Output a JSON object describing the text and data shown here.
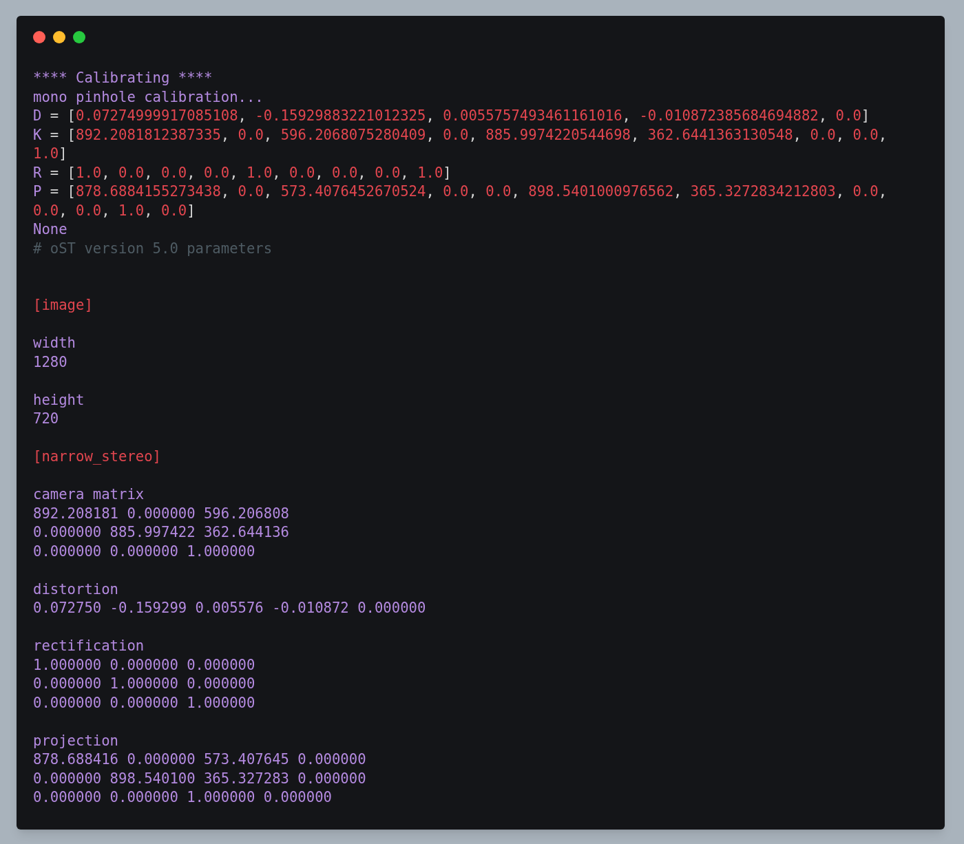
{
  "window": {
    "controls": [
      {
        "kind": "close"
      },
      {
        "kind": "minimize"
      },
      {
        "kind": "zoom"
      }
    ]
  },
  "blocks": [
    {
      "lines": [
        [
          {
            "kind": "label",
            "text": "**** Calibrating ****"
          }
        ],
        [
          {
            "kind": "label",
            "text": "mono pinhole calibration..."
          }
        ],
        [
          {
            "kind": "label",
            "text": "D"
          },
          {
            "kind": "punct",
            "text": " = ["
          },
          {
            "kind": "number",
            "text": "0.07274999917085108"
          },
          {
            "kind": "punct",
            "text": ", "
          },
          {
            "kind": "number",
            "text": "-0.15929883221012325"
          },
          {
            "kind": "punct",
            "text": ", "
          },
          {
            "kind": "number",
            "text": "0.0055757493461161016"
          },
          {
            "kind": "punct",
            "text": ", "
          },
          {
            "kind": "number",
            "text": "-0.010872385684694882"
          },
          {
            "kind": "punct",
            "text": ", "
          },
          {
            "kind": "number",
            "text": "0.0"
          },
          {
            "kind": "punct",
            "text": "]"
          }
        ],
        [
          {
            "kind": "label",
            "text": "K"
          },
          {
            "kind": "punct",
            "text": " = ["
          },
          {
            "kind": "number",
            "text": "892.2081812387335"
          },
          {
            "kind": "punct",
            "text": ", "
          },
          {
            "kind": "number",
            "text": "0.0"
          },
          {
            "kind": "punct",
            "text": ", "
          },
          {
            "kind": "number",
            "text": "596.2068075280409"
          },
          {
            "kind": "punct",
            "text": ", "
          },
          {
            "kind": "number",
            "text": "0.0"
          },
          {
            "kind": "punct",
            "text": ", "
          },
          {
            "kind": "number",
            "text": "885.9974220544698"
          },
          {
            "kind": "punct",
            "text": ", "
          },
          {
            "kind": "number",
            "text": "362.6441363130548"
          },
          {
            "kind": "punct",
            "text": ", "
          },
          {
            "kind": "number",
            "text": "0.0"
          },
          {
            "kind": "punct",
            "text": ", "
          },
          {
            "kind": "number",
            "text": "0.0"
          },
          {
            "kind": "punct",
            "text": ","
          }
        ],
        [
          {
            "kind": "number",
            "text": "1.0"
          },
          {
            "kind": "punct",
            "text": "]"
          }
        ],
        [
          {
            "kind": "label",
            "text": "R"
          },
          {
            "kind": "punct",
            "text": " = ["
          },
          {
            "kind": "number",
            "text": "1.0"
          },
          {
            "kind": "punct",
            "text": ", "
          },
          {
            "kind": "number",
            "text": "0.0"
          },
          {
            "kind": "punct",
            "text": ", "
          },
          {
            "kind": "number",
            "text": "0.0"
          },
          {
            "kind": "punct",
            "text": ", "
          },
          {
            "kind": "number",
            "text": "0.0"
          },
          {
            "kind": "punct",
            "text": ", "
          },
          {
            "kind": "number",
            "text": "1.0"
          },
          {
            "kind": "punct",
            "text": ", "
          },
          {
            "kind": "number",
            "text": "0.0"
          },
          {
            "kind": "punct",
            "text": ", "
          },
          {
            "kind": "number",
            "text": "0.0"
          },
          {
            "kind": "punct",
            "text": ", "
          },
          {
            "kind": "number",
            "text": "0.0"
          },
          {
            "kind": "punct",
            "text": ", "
          },
          {
            "kind": "number",
            "text": "1.0"
          },
          {
            "kind": "punct",
            "text": "]"
          }
        ],
        [
          {
            "kind": "label",
            "text": "P"
          },
          {
            "kind": "punct",
            "text": " = ["
          },
          {
            "kind": "number",
            "text": "878.6884155273438"
          },
          {
            "kind": "punct",
            "text": ", "
          },
          {
            "kind": "number",
            "text": "0.0"
          },
          {
            "kind": "punct",
            "text": ", "
          },
          {
            "kind": "number",
            "text": "573.4076452670524"
          },
          {
            "kind": "punct",
            "text": ", "
          },
          {
            "kind": "number",
            "text": "0.0"
          },
          {
            "kind": "punct",
            "text": ", "
          },
          {
            "kind": "number",
            "text": "0.0"
          },
          {
            "kind": "punct",
            "text": ", "
          },
          {
            "kind": "number",
            "text": "898.5401000976562"
          },
          {
            "kind": "punct",
            "text": ", "
          },
          {
            "kind": "number",
            "text": "365.3272834212803"
          },
          {
            "kind": "punct",
            "text": ", "
          },
          {
            "kind": "number",
            "text": "0.0"
          },
          {
            "kind": "punct",
            "text": ","
          }
        ],
        [
          {
            "kind": "number",
            "text": "0.0"
          },
          {
            "kind": "punct",
            "text": ", "
          },
          {
            "kind": "number",
            "text": "0.0"
          },
          {
            "kind": "punct",
            "text": ", "
          },
          {
            "kind": "number",
            "text": "1.0"
          },
          {
            "kind": "punct",
            "text": ", "
          },
          {
            "kind": "number",
            "text": "0.0"
          },
          {
            "kind": "punct",
            "text": "]"
          }
        ],
        [
          {
            "kind": "label",
            "text": "None"
          }
        ],
        [
          {
            "kind": "comment",
            "text": "# oST version 5.0 parameters"
          }
        ]
      ]
    },
    {
      "wide_gap": true,
      "lines": [
        [
          {
            "kind": "section",
            "text": "[image]"
          }
        ]
      ]
    },
    {
      "wide_gap": false,
      "lines": [
        [
          {
            "kind": "label",
            "text": "width"
          }
        ],
        [
          {
            "kind": "label",
            "text": "1280"
          }
        ]
      ]
    },
    {
      "wide_gap": false,
      "lines": [
        [
          {
            "kind": "label",
            "text": "height"
          }
        ],
        [
          {
            "kind": "label",
            "text": "720"
          }
        ]
      ]
    },
    {
      "wide_gap": false,
      "lines": [
        [
          {
            "kind": "section",
            "text": "[narrow_stereo]"
          }
        ]
      ]
    },
    {
      "wide_gap": false,
      "lines": [
        [
          {
            "kind": "label",
            "text": "camera matrix"
          }
        ],
        [
          {
            "kind": "label",
            "text": "892.208181 0.000000 596.206808"
          }
        ],
        [
          {
            "kind": "label",
            "text": "0.000000 885.997422 362.644136"
          }
        ],
        [
          {
            "kind": "label",
            "text": "0.000000 0.000000 1.000000"
          }
        ]
      ]
    },
    {
      "wide_gap": false,
      "lines": [
        [
          {
            "kind": "label",
            "text": "distortion"
          }
        ],
        [
          {
            "kind": "label",
            "text": "0.072750 -0.159299 0.005576 -0.010872 0.000000"
          }
        ]
      ]
    },
    {
      "wide_gap": false,
      "lines": [
        [
          {
            "kind": "label",
            "text": "rectification"
          }
        ],
        [
          {
            "kind": "label",
            "text": "1.000000 0.000000 0.000000"
          }
        ],
        [
          {
            "kind": "label",
            "text": "0.000000 1.000000 0.000000"
          }
        ],
        [
          {
            "kind": "label",
            "text": "0.000000 0.000000 1.000000"
          }
        ]
      ]
    },
    {
      "wide_gap": false,
      "lines": [
        [
          {
            "kind": "label",
            "text": "projection"
          }
        ],
        [
          {
            "kind": "label",
            "text": "878.688416 0.000000 573.407645 0.000000"
          }
        ],
        [
          {
            "kind": "label",
            "text": "0.000000 898.540100 365.327283 0.000000"
          }
        ],
        [
          {
            "kind": "label",
            "text": "0.000000 0.000000 1.000000 0.000000"
          }
        ]
      ]
    }
  ]
}
